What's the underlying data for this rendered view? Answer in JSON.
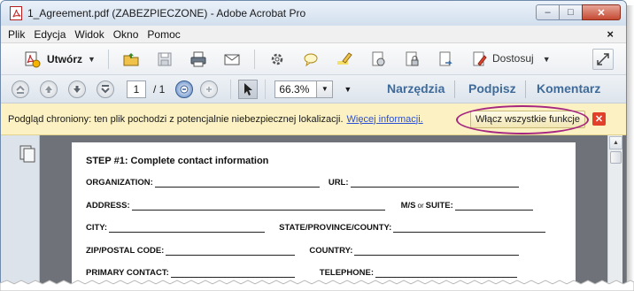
{
  "window": {
    "title": "1_Agreement.pdf (ZABEZPIECZONE) - Adobe Acrobat Pro",
    "controls": {
      "minimize": "‒",
      "maximize": "□",
      "close": "✕"
    }
  },
  "menu": {
    "items": [
      "Plik",
      "Edycja",
      "Widok",
      "Okno",
      "Pomoc"
    ],
    "close_glyph": "×"
  },
  "toolbar": {
    "create_label": "Utwórz",
    "customize_label": "Dostosuj",
    "icons": [
      "open-folder-icon",
      "save-icon",
      "print-icon",
      "email-icon",
      "settings-icon",
      "comment-icon",
      "highlight-icon",
      "sign-icon",
      "secure-icon",
      "share-icon",
      "edit-icon"
    ]
  },
  "navbar": {
    "current_page": "1",
    "total_pages": "/ 1",
    "zoom": "66.3%",
    "tabs": [
      "Narzędzia",
      "Podpisz",
      "Komentarz"
    ]
  },
  "protected_view": {
    "message": "Podgląd chroniony: ten plik pochodzi z potencjalnie niebezpiecznej lokalizacji.",
    "link": "Więcej informacji.",
    "enable_button": "Włącz wszystkie funkcje"
  },
  "document": {
    "title": "STEP #1: Complete contact information",
    "fields": {
      "organization": "ORGANIZATION:",
      "url": "URL:",
      "address": "ADDRESS:",
      "ms_suite_a": "M/S",
      "ms_suite_or": "or",
      "ms_suite_b": "SUITE:",
      "city": "CITY:",
      "state": "STATE/PROVINCE/COUNTY:",
      "zip": "ZIP/POSTAL CODE:",
      "country": "COUNTRY:",
      "primary_contact": "PRIMARY CONTACT:",
      "telephone": "TELEPHONE:"
    }
  },
  "colors": {
    "accent_tab": "#3f6b9a",
    "protected_bar": "#fbf1c3",
    "highlight_ellipse": "#a62580",
    "close_red": "#e2402a",
    "link": "#2a4fd4"
  }
}
